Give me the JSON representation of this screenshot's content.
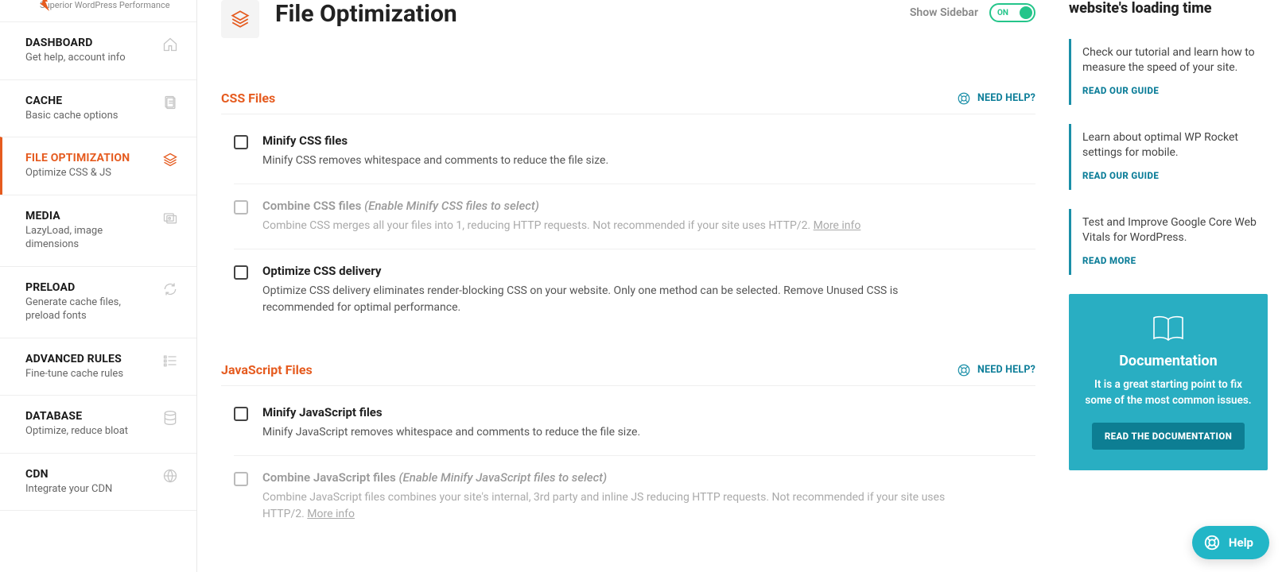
{
  "brand": {
    "tagline": "Superior WordPress Performance"
  },
  "show_sidebar": {
    "label": "Show Sidebar",
    "state": "ON"
  },
  "sidebar": {
    "items": [
      {
        "title": "DASHBOARD",
        "sub": "Get help, account info",
        "icon": "home-icon",
        "active": false
      },
      {
        "title": "CACHE",
        "sub": "Basic cache options",
        "icon": "page-icon",
        "active": false
      },
      {
        "title": "FILE OPTIMIZATION",
        "sub": "Optimize CSS & JS",
        "icon": "layers-icon",
        "active": true
      },
      {
        "title": "MEDIA",
        "sub": "LazyLoad, image dimensions",
        "icon": "images-icon",
        "active": false
      },
      {
        "title": "PRELOAD",
        "sub": "Generate cache files, preload fonts",
        "icon": "refresh-icon",
        "active": false
      },
      {
        "title": "ADVANCED RULES",
        "sub": "Fine-tune cache rules",
        "icon": "list-icon",
        "active": false
      },
      {
        "title": "DATABASE",
        "sub": "Optimize, reduce bloat",
        "icon": "database-icon",
        "active": false
      },
      {
        "title": "CDN",
        "sub": "Integrate your CDN",
        "icon": "globe-icon",
        "active": false
      }
    ]
  },
  "page": {
    "title": "File Optimization",
    "need_help": "NEED HELP?",
    "sections": [
      {
        "heading": "CSS Files",
        "options": [
          {
            "id": "minify-css",
            "title": "Minify CSS files",
            "desc": "Minify CSS removes whitespace and comments to reduce the file size.",
            "disabled": false
          },
          {
            "id": "combine-css",
            "title": "Combine CSS files",
            "hint": "(Enable Minify CSS files to select)",
            "desc": "Combine CSS merges all your files into 1, reducing HTTP requests. Not recommended if your site uses HTTP/2.",
            "more_info": "More info",
            "disabled": true
          },
          {
            "id": "optimize-css-delivery",
            "title": "Optimize CSS delivery",
            "desc": "Optimize CSS delivery eliminates render-blocking CSS on your website. Only one method can be selected. Remove Unused CSS is recommended for optimal performance.",
            "disabled": false
          }
        ]
      },
      {
        "heading": "JavaScript Files",
        "options": [
          {
            "id": "minify-js",
            "title": "Minify JavaScript files",
            "desc": "Minify JavaScript removes whitespace and comments to reduce the file size.",
            "disabled": false
          },
          {
            "id": "combine-js",
            "title": "Combine JavaScript files",
            "hint": "(Enable Minify JavaScript files to select)",
            "desc": "Combine JavaScript files combines your site's internal, 3rd party and inline JS reducing HTTP requests. Not recommended if your site uses HTTP/2.",
            "more_info": "More info",
            "disabled": true
          }
        ]
      }
    ]
  },
  "aside": {
    "title": "website's loading time",
    "tips": [
      {
        "text": "Check our tutorial and learn how to measure the speed of your site.",
        "link": "READ OUR GUIDE"
      },
      {
        "text": "Learn about optimal WP Rocket settings for mobile.",
        "link": "READ OUR GUIDE"
      },
      {
        "text": "Test and Improve Google Core Web Vitals for WordPress.",
        "link": "READ MORE"
      }
    ],
    "doc": {
      "title": "Documentation",
      "text": "It is a great starting point to fix some of the most common issues.",
      "button": "READ THE DOCUMENTATION"
    }
  },
  "help_pill": "Help"
}
